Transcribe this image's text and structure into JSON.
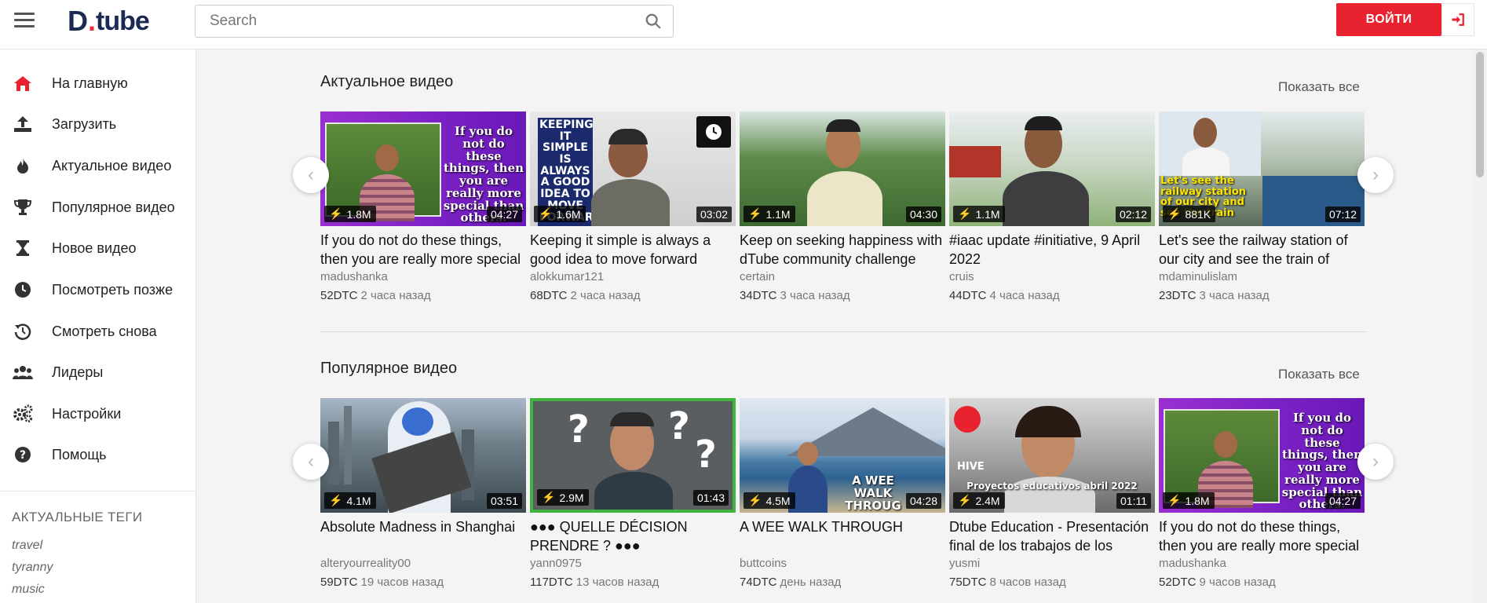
{
  "header": {
    "logo_d": "D",
    "logo_rest": "tube",
    "search_placeholder": "Search",
    "login_label": "ВОЙТИ"
  },
  "sidebar": {
    "items": [
      {
        "label": "На главную",
        "icon": "home-icon"
      },
      {
        "label": "Загрузить",
        "icon": "upload-icon"
      },
      {
        "label": "Актуальное видео",
        "icon": "fire-icon"
      },
      {
        "label": "Популярное видео",
        "icon": "trophy-icon"
      },
      {
        "label": "Новое видео",
        "icon": "hourglass-icon"
      },
      {
        "label": "Посмотреть позже",
        "icon": "clock-icon"
      },
      {
        "label": "Смотреть снова",
        "icon": "history-icon"
      },
      {
        "label": "Лидеры",
        "icon": "users-icon"
      },
      {
        "label": "Настройки",
        "icon": "gears-icon"
      },
      {
        "label": "Помощь",
        "icon": "help-icon"
      }
    ],
    "tags_title": "АКТУАЛЬНЫЕ ТЕГИ",
    "tags": [
      "travel",
      "tyranny",
      "music"
    ]
  },
  "sections": [
    {
      "title": "Актуальное видео",
      "show_all": "Показать все",
      "videos": [
        {
          "title": "If you do not do these things, then you are really more special than others.",
          "author": "madushanka",
          "dtc": "52DTC",
          "time": "2 часа назад",
          "views": "1.8M",
          "duration": "04:27",
          "overlay": "If you do not do these things, then you are really more special than others."
        },
        {
          "title": "Keeping it simple is always a good idea to move forward",
          "author": "alokkumar121",
          "dtc": "68DTC",
          "time": "2 часа назад",
          "views": "1.6M",
          "duration": "03:02",
          "overlay": "KEEPING IT SIMPLE IS ALWAYS A GOOD IDEA TO MOVE FORWARD"
        },
        {
          "title": "Keep on seeking happiness with dTube community challenge",
          "author": "certain",
          "dtc": "34DTC",
          "time": "3 часа назад",
          "views": "1.1M",
          "duration": "04:30"
        },
        {
          "title": "#iaac update #initiative, 9 April 2022",
          "author": "cruis",
          "dtc": "44DTC",
          "time": "4 часа назад",
          "views": "1.1M",
          "duration": "02:12"
        },
        {
          "title": "Let's see the railway station of our city and see the train of Bangladesh",
          "author": "mdaminulislam",
          "dtc": "23DTC",
          "time": "3 часа назад",
          "views": "881K",
          "duration": "07:12",
          "overlay": "Let's see the railway station of our city and see the train"
        }
      ]
    },
    {
      "title": "Популярное видео",
      "show_all": "Показать все",
      "videos": [
        {
          "title": "Absolute Madness in Shanghai",
          "author": "alteryourreality00",
          "dtc": "59DTC",
          "time": "19 часов назад",
          "views": "4.1M",
          "duration": "03:51"
        },
        {
          "title": "●●● QUELLE DÉCISION PRENDRE ? ●●●",
          "author": "yann0975",
          "dtc": "117DTC",
          "time": "13 часов назад",
          "views": "2.9M",
          "duration": "01:43"
        },
        {
          "title": "A WEE WALK THROUGH",
          "author": "buttcoins",
          "dtc": "74DTC",
          "time": "день назад",
          "views": "4.5M",
          "duration": "04:28",
          "overlay": "A WEE WALK THROUG"
        },
        {
          "title": "Dtube Education - Presentación final de los trabajos de los educativos",
          "author": "yusmi",
          "dtc": "75DTC",
          "time": "8 часов назад",
          "views": "2.4M",
          "duration": "01:11",
          "overlay": "Proyectos educativos abril 2022"
        },
        {
          "title": "If you do not do these things, then you are really more special than others.",
          "author": "madushanka",
          "dtc": "52DTC",
          "time": "9 часов назад",
          "views": "1.8M",
          "duration": "04:27",
          "overlay": "If you do not do these things, then you are really more special than others."
        }
      ]
    }
  ]
}
